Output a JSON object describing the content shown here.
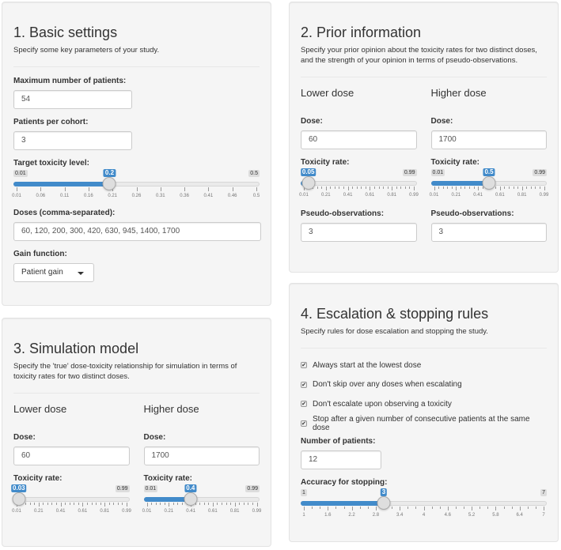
{
  "basic": {
    "title": "1. Basic settings",
    "description": "Specify some key parameters of your study.",
    "max_patients": {
      "label": "Maximum number of patients:",
      "value": "54"
    },
    "cohort": {
      "label": "Patients per cohort:",
      "value": "3"
    },
    "target_tox": {
      "label": "Target toxicity level:",
      "min": 0.01,
      "max": 0.5,
      "value": 0.2,
      "min_label": "0.01",
      "max_label": "0.5",
      "value_label": "0.2",
      "ticks": [
        "0.01",
        "0.06",
        "0.11",
        "0.16",
        "0.21",
        "0.26",
        "0.31",
        "0.36",
        "0.41",
        "0.46",
        "0.5"
      ]
    },
    "doses": {
      "label": "Doses (comma-separated):",
      "value": "60, 120, 200, 300, 420, 630, 945, 1400, 1700"
    },
    "gain": {
      "label": "Gain function:",
      "value": "Patient gain"
    }
  },
  "prior": {
    "title": "2. Prior information",
    "description": "Specify your prior opinion about the toxicity rates for two distinct doses, and the strength of your opinion in terms of pseudo-observations.",
    "lower": {
      "heading": "Lower dose",
      "dose_label": "Dose:",
      "dose_value": "60",
      "tox_label": "Toxicity rate:",
      "tox": {
        "min": 0.01,
        "max": 0.99,
        "value": 0.05,
        "min_label": "0.01",
        "max_label": "0.99",
        "value_label": "0.05",
        "ticks": [
          "0.01",
          "0.21",
          "0.41",
          "0.61",
          "0.81",
          "0.99"
        ]
      },
      "pseudo_label": "Pseudo-observations:",
      "pseudo_value": "3"
    },
    "higher": {
      "heading": "Higher dose",
      "dose_label": "Dose:",
      "dose_value": "1700",
      "tox_label": "Toxicity rate:",
      "tox": {
        "min": 0.01,
        "max": 0.99,
        "value": 0.5,
        "min_label": "0.01",
        "max_label": "0.99",
        "value_label": "0.5",
        "ticks": [
          "0.01",
          "0.21",
          "0.41",
          "0.61",
          "0.81",
          "0.99"
        ]
      },
      "pseudo_label": "Pseudo-observations:",
      "pseudo_value": "3"
    }
  },
  "sim": {
    "title": "3. Simulation model",
    "description": "Specify the 'true' dose-toxicity relationship for simulation in terms of toxicity rates for two distinct doses.",
    "lower": {
      "heading": "Lower dose",
      "dose_label": "Dose:",
      "dose_value": "60",
      "tox_label": "Toxicity rate:",
      "tox": {
        "min": 0.01,
        "max": 0.99,
        "value": 0.03,
        "min_label": "0.01",
        "max_label": "0.99",
        "value_label": "0.03",
        "ticks": [
          "0.01",
          "0.21",
          "0.41",
          "0.61",
          "0.81",
          "0.99"
        ]
      }
    },
    "higher": {
      "heading": "Higher dose",
      "dose_label": "Dose:",
      "dose_value": "1700",
      "tox_label": "Toxicity rate:",
      "tox": {
        "min": 0.01,
        "max": 0.99,
        "value": 0.4,
        "min_label": "0.01",
        "max_label": "0.99",
        "value_label": "0.4",
        "ticks": [
          "0.01",
          "0.21",
          "0.41",
          "0.61",
          "0.81",
          "0.99"
        ]
      }
    }
  },
  "rules": {
    "title": "4. Escalation & stopping rules",
    "description": "Specify rules for dose escalation and stopping the study.",
    "checks": [
      {
        "label": "Always start at the lowest dose",
        "checked": true
      },
      {
        "label": "Don't skip over any doses when escalating",
        "checked": true
      },
      {
        "label": "Don't escalate upon observing a toxicity",
        "checked": true
      },
      {
        "label": "Stop after a given number of consecutive patients at the same dose",
        "checked": true
      }
    ],
    "num_patients": {
      "label": "Number of patients:",
      "value": "12"
    },
    "accuracy": {
      "label": "Accuracy for stopping:",
      "min": 1,
      "max": 7,
      "value": 3,
      "min_label": "1",
      "max_label": "7",
      "value_label": "3",
      "ticks": [
        "1",
        "1.6",
        "2.2",
        "2.8",
        "3.4",
        "4",
        "4.6",
        "5.2",
        "5.8",
        "6.4",
        "7"
      ]
    }
  },
  "colors": {
    "accent": "#428bca",
    "panel_bg": "#f5f5f5"
  }
}
